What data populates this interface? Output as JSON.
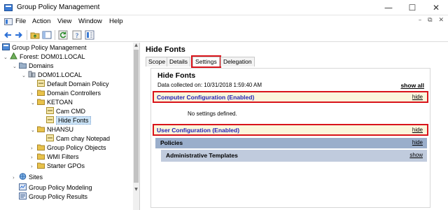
{
  "window": {
    "title": "Group Policy Management",
    "controls": {
      "minimize": "—",
      "maximize": "☐",
      "close": "✕"
    }
  },
  "menubar": {
    "items": [
      "File",
      "Action",
      "View",
      "Window",
      "Help"
    ],
    "mdi_controls": [
      "–",
      "⧉",
      "✕"
    ]
  },
  "toolbar": {
    "buttons": [
      "back-arrow-icon",
      "forward-arrow-icon",
      "up-folder-icon",
      "show-hide-tree-icon",
      "refresh-icon",
      "help-icon",
      "properties-icon"
    ]
  },
  "tree": {
    "items": [
      {
        "label": "Group Policy Management",
        "icon": "gpm-icon",
        "expander": ""
      },
      {
        "label": "Forest: DOM01.LOCAL",
        "icon": "forest-icon",
        "expander": "⌄"
      },
      {
        "label": "Domains",
        "icon": "domains-folder-icon",
        "expander": "⌄"
      },
      {
        "label": "DOM01.LOCAL",
        "icon": "domain-icon",
        "expander": "⌄"
      },
      {
        "label": "Default Domain Policy",
        "icon": "gpo-link-icon",
        "expander": ""
      },
      {
        "label": "Domain Controllers",
        "icon": "ou-icon",
        "expander": "›"
      },
      {
        "label": "KETOAN",
        "icon": "ou-icon",
        "expander": "⌄"
      },
      {
        "label": "Cam CMD",
        "icon": "gpo-link-icon",
        "expander": ""
      },
      {
        "label": "Hide Fonts",
        "icon": "gpo-link-icon",
        "expander": ""
      },
      {
        "label": "NHANSU",
        "icon": "ou-icon",
        "expander": "⌄"
      },
      {
        "label": "Cam chay Notepad",
        "icon": "gpo-link-icon",
        "expander": ""
      },
      {
        "label": "Group Policy Objects",
        "icon": "folder-icon",
        "expander": "›"
      },
      {
        "label": "WMI Filters",
        "icon": "folder-icon",
        "expander": "›"
      },
      {
        "label": "Starter GPOs",
        "icon": "folder-icon",
        "expander": "›"
      },
      {
        "label": "Sites",
        "icon": "sites-icon",
        "expander": "›"
      },
      {
        "label": "Group Policy Modeling",
        "icon": "modeling-icon",
        "expander": ""
      },
      {
        "label": "Group Policy Results",
        "icon": "results-icon",
        "expander": ""
      }
    ],
    "selected_index": 8
  },
  "content": {
    "title": "Hide Fonts",
    "tabs": [
      "Scope",
      "Details",
      "Settings",
      "Delegation"
    ],
    "active_tab": "Settings",
    "report": {
      "title": "Hide Fonts",
      "collected": "Data collected on: 10/31/2018 1:59:40 AM",
      "show_all": "show all",
      "computer_section": {
        "label": "Computer Configuration (Enabled)",
        "link": "hide"
      },
      "no_settings": "No settings defined.",
      "user_section": {
        "label": "User Configuration (Enabled)",
        "link": "hide"
      },
      "policies": {
        "label": "Policies",
        "link": "hide"
      },
      "admin_templates": {
        "label": "Administrative Templates",
        "link": "show"
      }
    }
  },
  "colors": {
    "highlight_red": "#d9141b",
    "section_bg": "#fbf6dc",
    "section_text": "#2323b4",
    "band_dark": "#9aaecb",
    "band_light": "#c0cbdd",
    "selection": "#cce4f7"
  }
}
